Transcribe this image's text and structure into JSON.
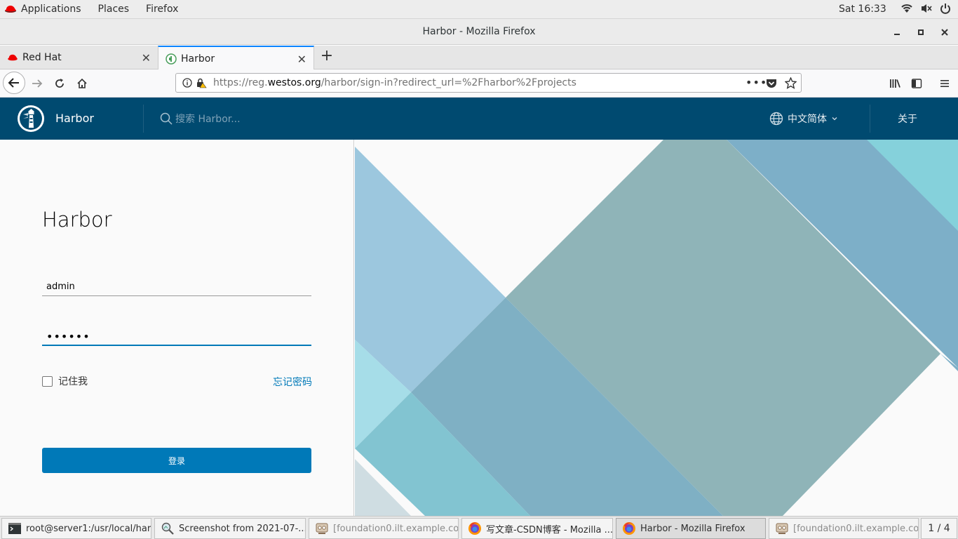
{
  "topbar": {
    "applications": "Applications",
    "places": "Places",
    "firefox": "Firefox",
    "clock": "Sat 16:33"
  },
  "window": {
    "title": "Harbor - Mozilla Firefox"
  },
  "tabs": [
    {
      "label": "Red Hat"
    },
    {
      "label": "Harbor"
    }
  ],
  "url": {
    "prefix": "https://reg.",
    "host": "westos.org",
    "path": "/harbor/sign-in?redirect_url=%2Fharbor%2Fprojects"
  },
  "harbor": {
    "brand": "Harbor",
    "search_placeholder": "搜索 Harbor...",
    "language": "中文简体",
    "about": "关于"
  },
  "login": {
    "title": "Harbor",
    "username": "admin",
    "password": "••••••",
    "remember": "记住我",
    "forgot": "忘记密码",
    "submit": "登录"
  },
  "taskbar": [
    {
      "label": "root@server1:/usr/local/har...",
      "icon": "terminal-icon"
    },
    {
      "label": "Screenshot from 2021-07-...",
      "icon": "image-viewer-icon"
    },
    {
      "label": "[foundation0.ilt.example.co...",
      "icon": "virt-viewer-icon"
    },
    {
      "label": "写文章-CSDN博客 - Mozilla ...",
      "icon": "firefox-icon"
    },
    {
      "label": "Harbor - Mozilla Firefox",
      "icon": "firefox-icon"
    },
    {
      "label": "[foundation0.ilt.example.co...",
      "icon": "virt-viewer-icon"
    }
  ],
  "workspace": "1 / 4",
  "colors": {
    "harbor_header": "#004a70",
    "primary": "#0079b8",
    "tab_accent": "#0a84ff"
  }
}
